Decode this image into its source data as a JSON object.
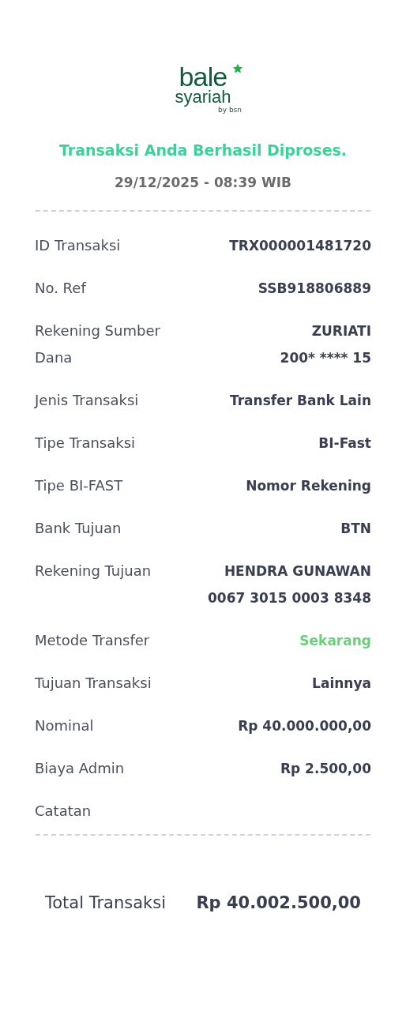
{
  "logo": {
    "word": "bale",
    "sub": "syariah",
    "by": "by bsn"
  },
  "title": "Transaksi Anda Berhasil Diproses.",
  "datetime": "29/12/2025 - 08:39 WIB",
  "rows": [
    {
      "label": [
        "ID Transaksi"
      ],
      "value": [
        "TRX000001481720"
      ],
      "accent": false
    },
    {
      "label": [
        "No. Ref"
      ],
      "value": [
        "SSB918806889"
      ],
      "accent": false
    },
    {
      "label": [
        "Rekening Sumber",
        "Dana"
      ],
      "value": [
        "ZURIATI",
        "200* **** 15"
      ],
      "accent": false
    },
    {
      "label": [
        "Jenis Transaksi"
      ],
      "value": [
        "Transfer Bank Lain"
      ],
      "accent": false
    },
    {
      "label": [
        "Tipe Transaksi"
      ],
      "value": [
        "BI-Fast"
      ],
      "accent": false
    },
    {
      "label": [
        "Tipe BI-FAST"
      ],
      "value": [
        "Nomor Rekening"
      ],
      "accent": false
    },
    {
      "label": [
        "Bank Tujuan"
      ],
      "value": [
        "BTN"
      ],
      "accent": false
    },
    {
      "label": [
        "Rekening Tujuan"
      ],
      "value": [
        "HENDRA GUNAWAN",
        "0067 3015 0003 8348"
      ],
      "accent": false
    },
    {
      "label": [
        "Metode Transfer"
      ],
      "value": [
        "Sekarang"
      ],
      "accent": true
    },
    {
      "label": [
        "Tujuan Transaksi"
      ],
      "value": [
        "Lainnya"
      ],
      "accent": false
    },
    {
      "label": [
        "Nominal"
      ],
      "value": [
        "Rp 40.000.000,00"
      ],
      "accent": false
    },
    {
      "label": [
        "Biaya Admin"
      ],
      "value": [
        "Rp 2.500,00"
      ],
      "accent": false
    },
    {
      "label": [
        "Catatan"
      ]
    }
  ],
  "total": {
    "label": "Total Transaksi",
    "value": "Rp 40.002.500,00"
  }
}
